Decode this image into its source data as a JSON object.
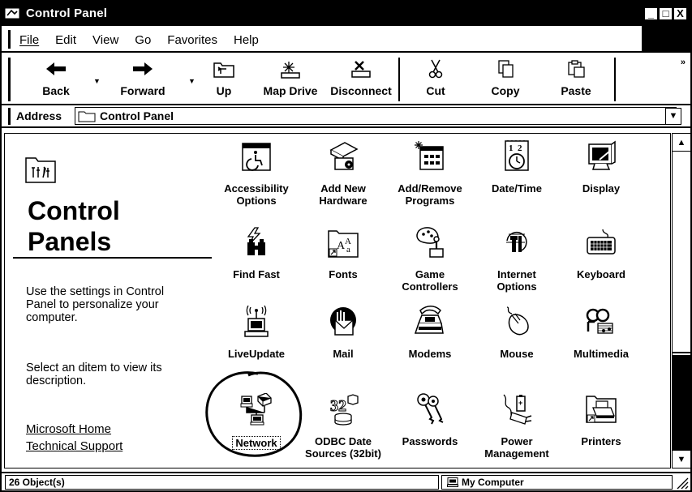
{
  "window": {
    "title": "Control Panel",
    "minimize_label": "_",
    "maximize_label": "□",
    "close_label": "X"
  },
  "menu": {
    "items": [
      {
        "label": "File"
      },
      {
        "label": "Edit"
      },
      {
        "label": "View"
      },
      {
        "label": "Go"
      },
      {
        "label": "Favorites"
      },
      {
        "label": "Help"
      }
    ]
  },
  "toolbar": {
    "back": "Back",
    "forward": "Forward",
    "up": "Up",
    "map_drive": "Map Drive",
    "disconnect": "Disconnect",
    "cut": "Cut",
    "copy": "Copy",
    "paste": "Paste",
    "more": "»"
  },
  "address": {
    "label": "Address",
    "value": "Control Panel"
  },
  "left_pane": {
    "title_line1": "Control",
    "title_line2": "Panels",
    "paragraph1": "Use the settings in Control Panel to personalize your computer.",
    "paragraph2": "Select an ditem to view its description.",
    "link1": "Microsoft Home",
    "link2": "Technical Support"
  },
  "items": {
    "accessibility": {
      "line1": "Accessibility",
      "line2": "Options",
      "icon": "accessibility-icon"
    },
    "add_hardware": {
      "line1": "Add New",
      "line2": "Hardware",
      "icon": "add-hardware-icon"
    },
    "add_remove": {
      "line1": "Add/Remove",
      "line2": "Programs",
      "icon": "add-remove-programs-icon"
    },
    "datetime": {
      "line1": "Date/Time",
      "line2": "",
      "icon": "date-time-icon"
    },
    "display": {
      "line1": "Display",
      "line2": "",
      "icon": "display-icon"
    },
    "findfast": {
      "line1": "Find Fast",
      "line2": "",
      "icon": "find-fast-icon"
    },
    "fonts": {
      "line1": "Fonts",
      "line2": "",
      "icon": "fonts-icon"
    },
    "game": {
      "line1": "Game",
      "line2": "Controllers",
      "icon": "game-controllers-icon"
    },
    "internet": {
      "line1": "Internet",
      "line2": "Options",
      "icon": "internet-options-icon"
    },
    "keyboard": {
      "line1": "Keyboard",
      "line2": "",
      "icon": "keyboard-icon"
    },
    "liveupdate": {
      "line1": "LiveUpdate",
      "line2": "",
      "icon": "liveupdate-icon"
    },
    "mail": {
      "line1": "Mail",
      "line2": "",
      "icon": "mail-icon"
    },
    "modems": {
      "line1": "Modems",
      "line2": "",
      "icon": "modem-icon"
    },
    "mouse": {
      "line1": "Mouse",
      "line2": "",
      "icon": "mouse-icon"
    },
    "multimedia": {
      "line1": "Multimedia",
      "line2": "",
      "icon": "multimedia-icon"
    },
    "network": {
      "line1": "Network",
      "line2": "",
      "icon": "network-icon"
    },
    "odbc": {
      "line1": "ODBC Date",
      "line2": "Sources (32bit)",
      "icon": "odbc-icon"
    },
    "passwords": {
      "line1": "Passwords",
      "line2": "",
      "icon": "passwords-icon"
    },
    "power": {
      "line1": "Power",
      "line2": "Management",
      "icon": "power-management-icon"
    },
    "printers": {
      "line1": "Printers",
      "line2": "",
      "icon": "printers-icon"
    }
  },
  "status": {
    "objects": "26 Object(s)",
    "zone": "My Computer"
  }
}
